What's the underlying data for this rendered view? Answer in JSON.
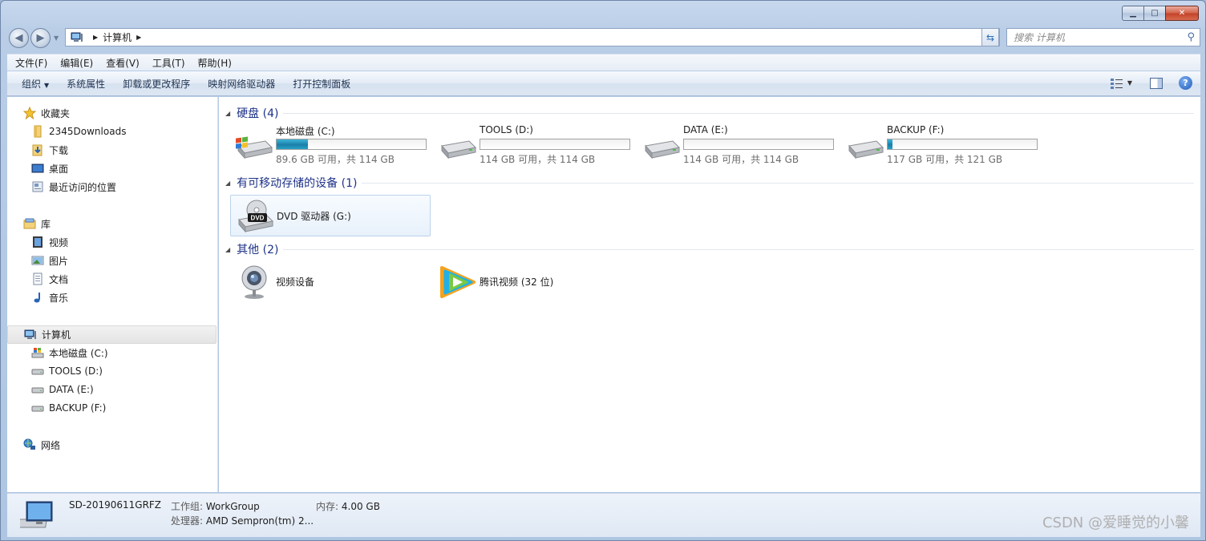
{
  "window": {
    "caption_buttons": {
      "min_icon": "minimize-icon",
      "max_icon": "maximize-icon",
      "close_icon": "close-icon",
      "min": "▁",
      "max": "□",
      "close": "✕"
    }
  },
  "address": {
    "crumb": "计算机",
    "search_placeholder": "搜索 计算机"
  },
  "menu": [
    "文件(F)",
    "编辑(E)",
    "查看(V)",
    "工具(T)",
    "帮助(H)"
  ],
  "toolbar": {
    "organize": "组织",
    "items": [
      "系统属性",
      "卸载或更改程序",
      "映射网络驱动器",
      "打开控制面板"
    ]
  },
  "nav": {
    "favorites": {
      "label": "收藏夹",
      "items": [
        "2345Downloads",
        "下载",
        "桌面",
        "最近访问的位置"
      ]
    },
    "libraries": {
      "label": "库",
      "items": [
        "视频",
        "图片",
        "文档",
        "音乐"
      ]
    },
    "computer": {
      "label": "计算机",
      "items": [
        "本地磁盘 (C:)",
        "TOOLS (D:)",
        "DATA (E:)",
        "BACKUP (F:)"
      ]
    },
    "network": {
      "label": "网络"
    }
  },
  "groups": {
    "hdd": "硬盘 (4)",
    "removable": "有可移动存储的设备 (1)",
    "other": "其他 (2)"
  },
  "drives": [
    {
      "name": "本地磁盘 (C:)",
      "free_text": "89.6 GB 可用，共 114 GB",
      "used_fraction": 0.21
    },
    {
      "name": "TOOLS (D:)",
      "free_text": "114 GB 可用，共 114 GB",
      "used_fraction": 0.0
    },
    {
      "name": "DATA (E:)",
      "free_text": "114 GB 可用，共 114 GB",
      "used_fraction": 0.0
    },
    {
      "name": "BACKUP (F:)",
      "free_text": "117 GB 可用，共 121 GB",
      "used_fraction": 0.03
    }
  ],
  "removable": [
    {
      "name": "DVD 驱动器 (G:)",
      "badge": "DVD"
    }
  ],
  "other": [
    {
      "name": "视频设备"
    },
    {
      "name": "腾讯视频 (32 位)"
    }
  ],
  "details": {
    "computer_name": "SD-20190611GRFZ",
    "workgroup_label": "工作组:",
    "workgroup": "WorkGroup",
    "memory_label": "内存:",
    "memory": "4.00 GB",
    "cpu_label": "处理器:",
    "cpu": "AMD Sempron(tm) 2..."
  },
  "watermark": "CSDN @爱睡觉的小馨",
  "colors": {
    "group_title": "#1e3287",
    "bar_fill": "#1a7fa9",
    "accent": "#2c6fb8"
  }
}
